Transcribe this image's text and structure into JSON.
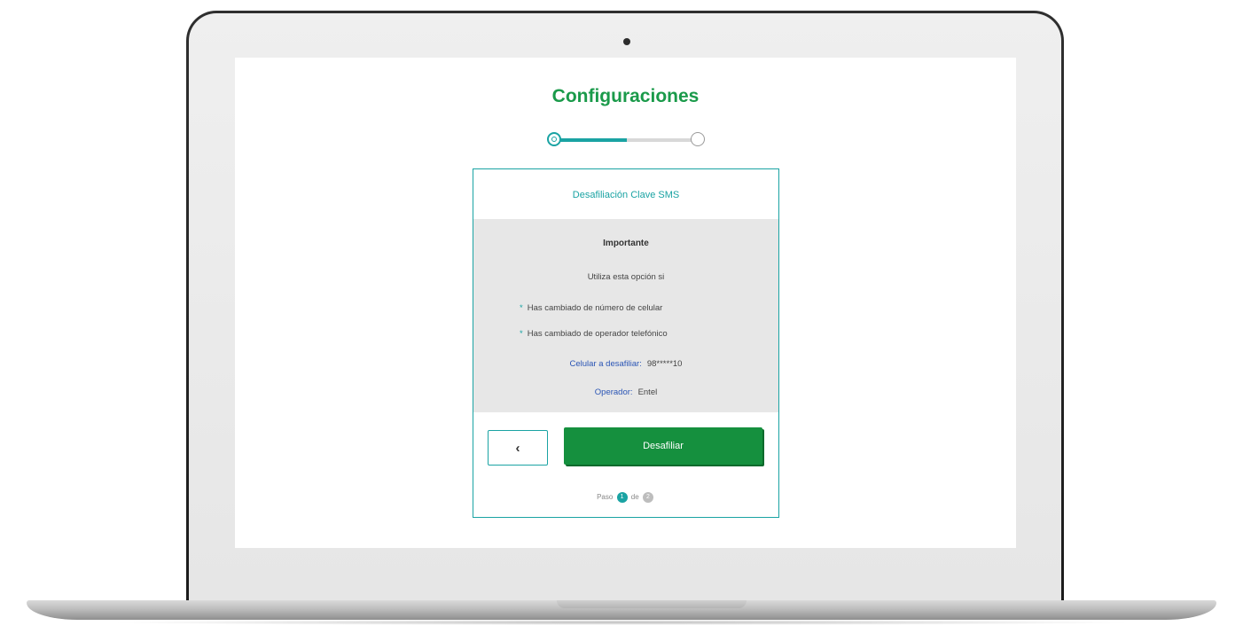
{
  "page": {
    "title": "Configuraciones"
  },
  "stepper": {
    "progress": 0.5
  },
  "card": {
    "header": "Desafiliación Clave SMS",
    "info": {
      "title": "Importante",
      "subtitle": "Utiliza esta opción si",
      "bullets": [
        "Has cambiado de número de celular",
        "Has cambiado de operador telefónico"
      ],
      "phone_label": "Celular a desafiliar:",
      "phone_value": "98*****10",
      "operator_label": "Operador:",
      "operator_value": "Entel"
    },
    "back_button": "‹",
    "primary_button": "Desafiliar",
    "step": {
      "prefix": "Paso",
      "current": "1",
      "separator": "de",
      "total": "2"
    }
  },
  "colors": {
    "brand_green": "#1a9a4a",
    "button_green": "#15903e",
    "teal": "#1aa3a3",
    "label_blue": "#2a55b5"
  },
  "icons": {
    "back": "chevron-left-icon",
    "bullet": "asterisk-icon"
  }
}
